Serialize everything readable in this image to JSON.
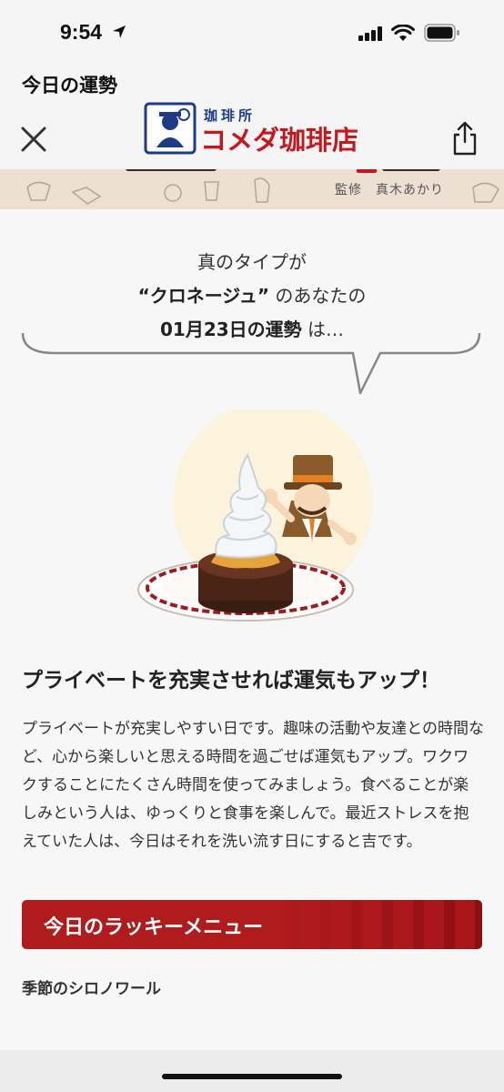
{
  "status_bar": {
    "time": "9:54"
  },
  "header": {
    "page_label": "今日の運勢",
    "logo_text": "コメダ珈琲店",
    "logo_subtext": "珈琲所"
  },
  "banner": {
    "credit": "監修　真木あかり"
  },
  "intro": {
    "line1": "真のタイプが",
    "type_name": "“クロネージュ”",
    "line2_suffix": " のあなたの",
    "date": "01月23日の運勢",
    "line3_suffix": " は…"
  },
  "fortune": {
    "headline": "プライベートを充実させれば運気もアップ！",
    "body": "プライベートが充実しやすい日です。趣味の活動や友達との時間など、心から楽しいと思える時間を過ごせば運気もアップ。ワクワクすることにたくさん時間を使ってみましょう。食べることが楽しみという人は、ゆっくりと食事を楽しんで。最近ストレスを抱えていた人は、今日はそれを洗い流す日にすると吉です。"
  },
  "lucky_menu": {
    "title": "今日のラッキーメニュー",
    "item": "季節のシロノワール"
  },
  "colors": {
    "accent": "#b01b1e",
    "background": "#f7f7f7"
  }
}
